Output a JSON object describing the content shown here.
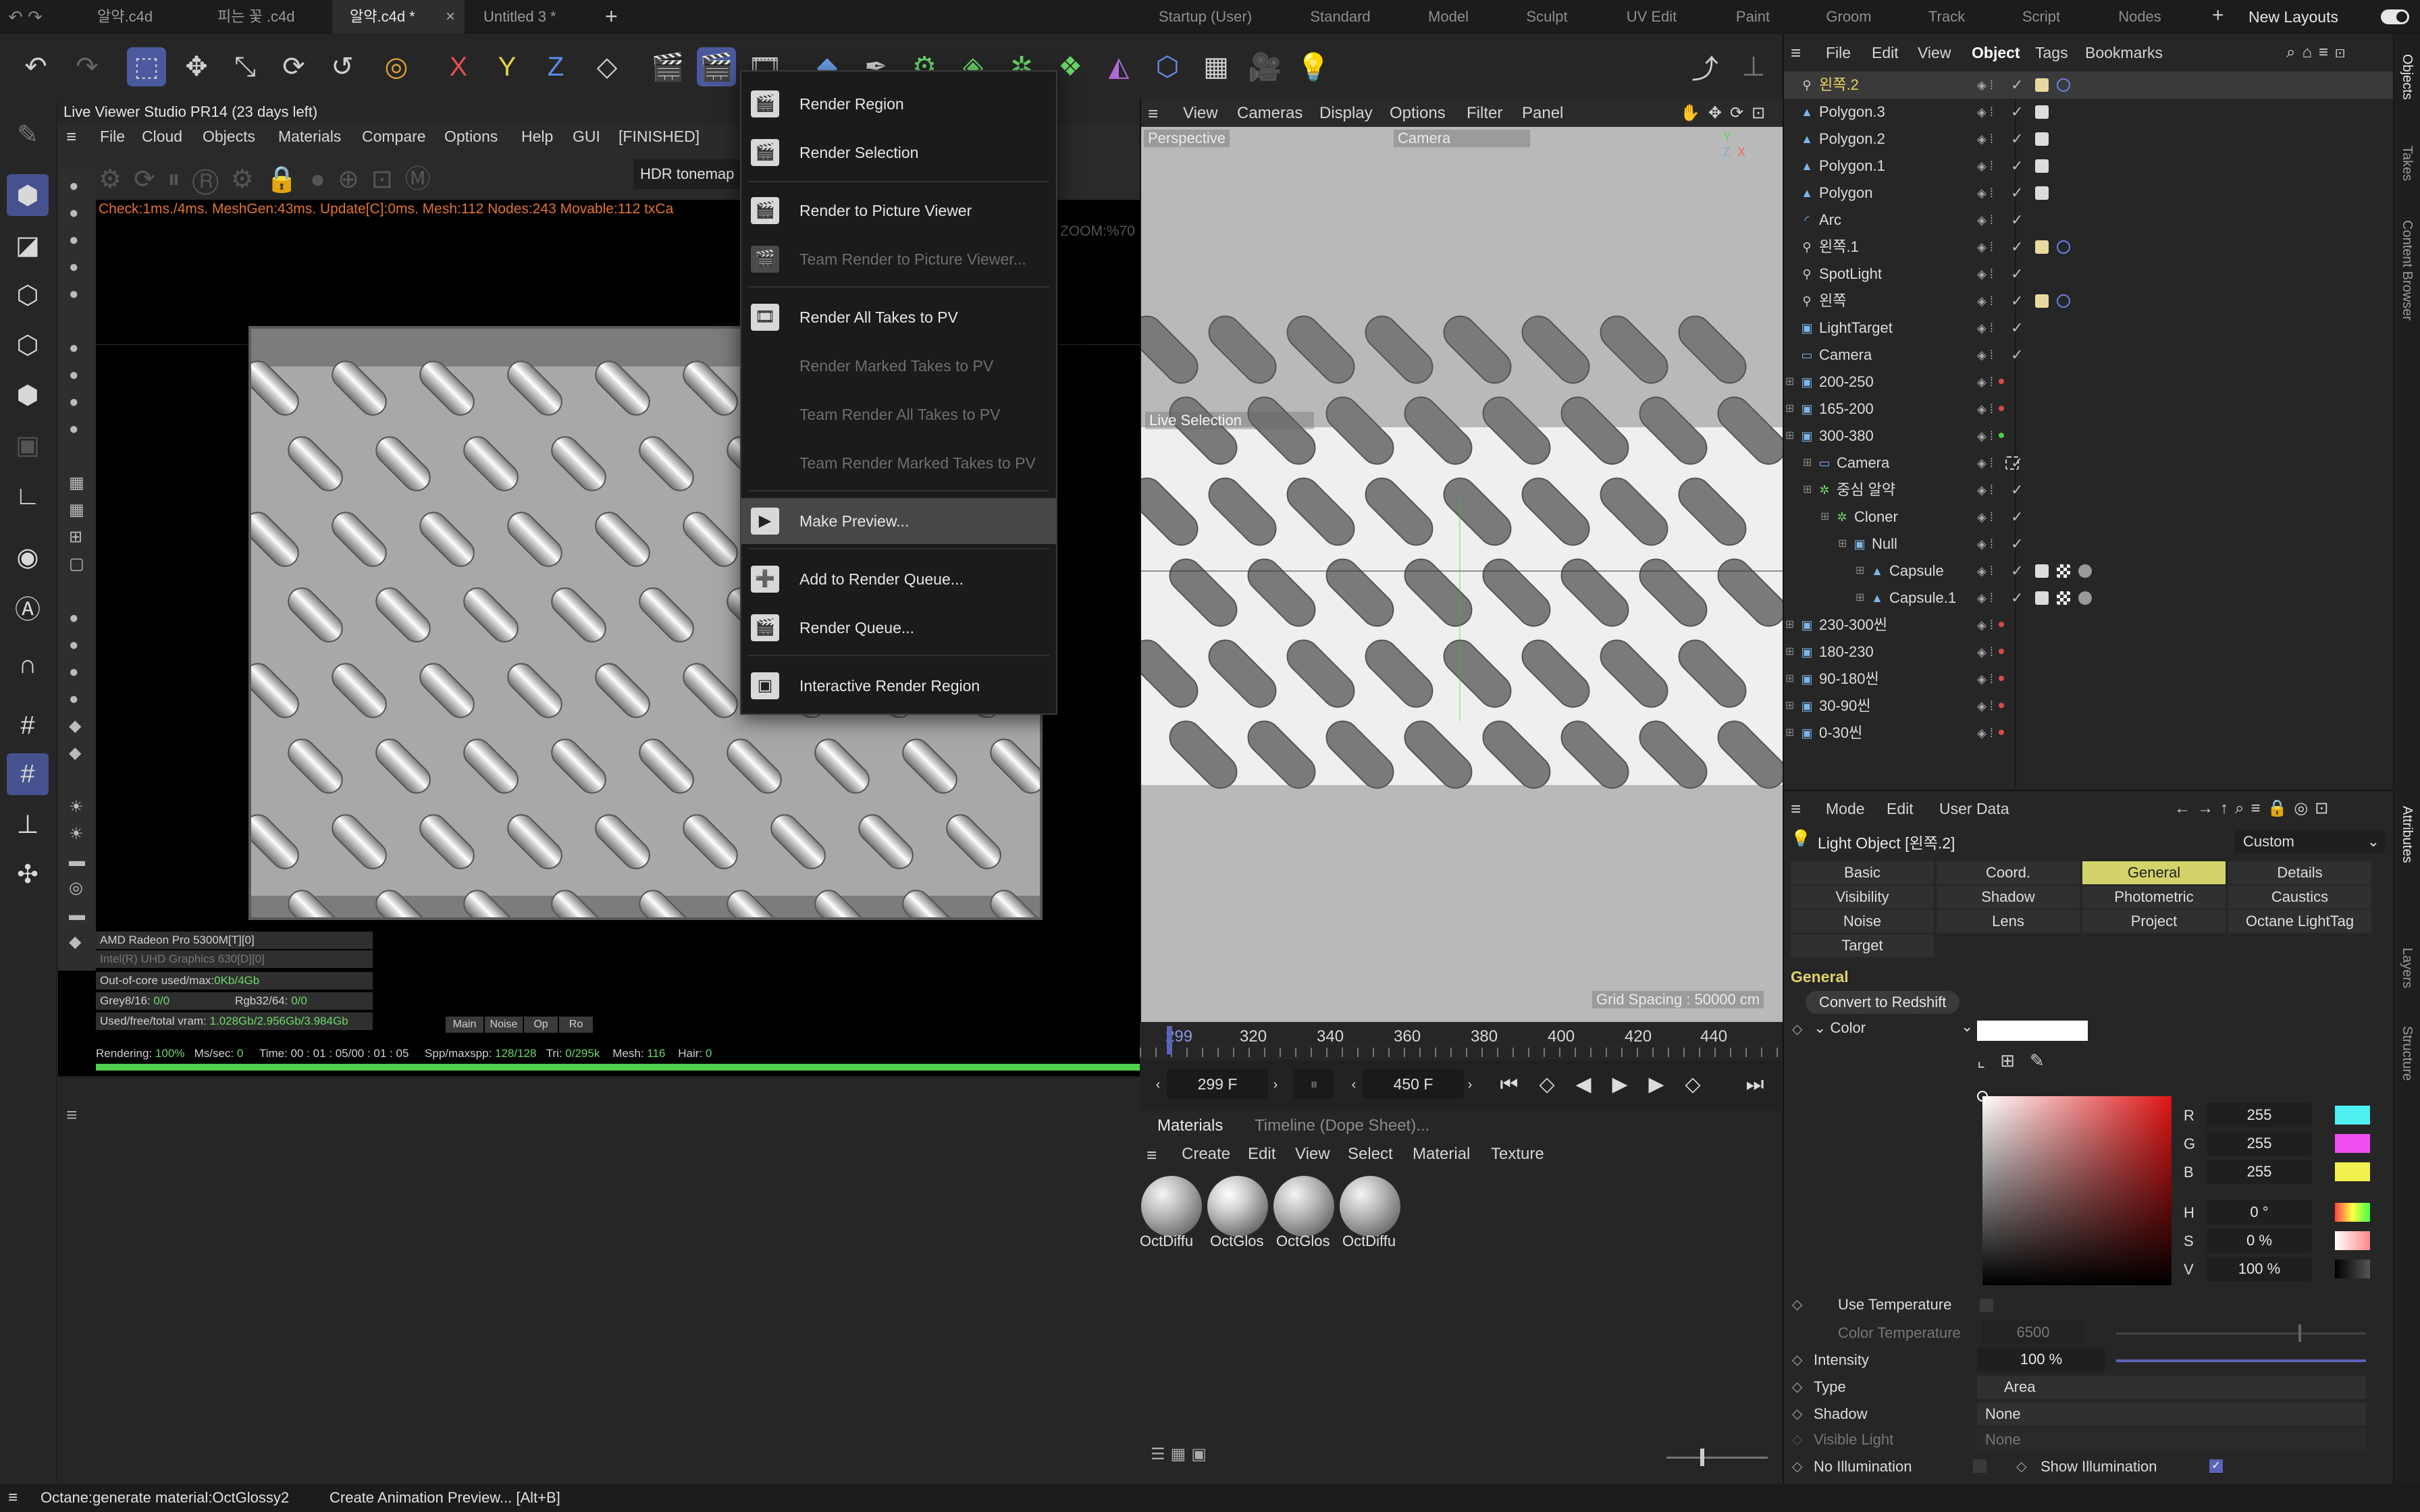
{
  "doc_tabs": [
    "알약.c4d",
    "피는 꽃 .c4d",
    "알약.c4d *",
    "Untitled 3 *"
  ],
  "layouts": [
    "Startup (User)",
    "Standard",
    "Model",
    "Sculpt",
    "UV Edit",
    "Paint",
    "Groom",
    "Track",
    "Script",
    "Nodes"
  ],
  "new_layouts": "New Layouts",
  "toolbar": {
    "x": "X",
    "y": "Y",
    "z": "Z"
  },
  "live_viewer": {
    "title": "Live Viewer Studio PR14 (23 days left)",
    "menu": [
      "File",
      "Cloud",
      "Objects",
      "Materials",
      "Compare",
      "Options",
      "Help",
      "GUI",
      "[FINISHED]"
    ],
    "tonemap": "HDR tonemap",
    "status": "Check:1ms./4ms. MeshGen:43ms. Update[C]:0ms. Mesh:112 Nodes:243 Movable:112 txCa",
    "zoom": "ZOOM:%70",
    "gpu1": "AMD Radeon Pro 5300M[T][0]",
    "gpu2": "Intel(R) UHD Graphics 630[D][0]",
    "outofcore": {
      "label": "Out-of-core used/max:",
      "value": "0Kb/4Gb"
    },
    "grey": {
      "label": "Grey8/16:",
      "value": "0/0"
    },
    "rgb": {
      "label": "Rgb32/64:",
      "value": "0/0"
    },
    "vram": {
      "label": "Used/free/total vram:",
      "value": "1.028Gb/2.956Gb/3.984Gb"
    },
    "mini_tabs": [
      "Main",
      "Noise",
      "Op",
      "Ro"
    ],
    "render_line": {
      "rendering_label": "Rendering:",
      "rendering": "100%",
      "ms_label": "Ms/sec:",
      "ms": "0",
      "time": "Time: 00 : 01 : 05/00 : 01 : 05",
      "spp_label": "Spp/maxspp:",
      "spp": "128/128",
      "tri_label": "Tri:",
      "tri": "0/295k",
      "mesh_label": "Mesh:",
      "mesh": "116",
      "hair_label": "Hair:",
      "hair": "0"
    },
    "progress": 1.0
  },
  "render_menu": {
    "items": [
      {
        "label": "Render Region",
        "enabled": true
      },
      {
        "label": "Render Selection",
        "enabled": true
      },
      {
        "label": "Render to Picture Viewer",
        "enabled": true
      },
      {
        "label": "Team Render to Picture Viewer...",
        "enabled": false
      },
      {
        "label": "Render All Takes to PV",
        "enabled": true
      },
      {
        "label": "Render Marked Takes to PV",
        "enabled": false
      },
      {
        "label": "Team Render All Takes to PV",
        "enabled": false
      },
      {
        "label": "Team Render Marked Takes to PV",
        "enabled": false
      },
      {
        "label": "Make Preview...",
        "enabled": true,
        "highlighted": true
      },
      {
        "label": "Add to Render Queue...",
        "enabled": true
      },
      {
        "label": "Render Queue...",
        "enabled": true
      },
      {
        "label": "Interactive Render Region",
        "enabled": true
      }
    ]
  },
  "viewport": {
    "menu": [
      "View",
      "Cameras",
      "Display",
      "Options",
      "Filter",
      "Panel"
    ],
    "projection": "Perspective",
    "camera": "Camera",
    "live_selection": "Live Selection",
    "grid_spacing": "Grid Spacing : 50000 cm"
  },
  "timeline": {
    "ticks": [
      "299",
      "320",
      "340",
      "360",
      "380",
      "400",
      "420",
      "440"
    ],
    "current_frame": "299 F",
    "end_frame": "450 F"
  },
  "materials": {
    "tabs": [
      "Materials",
      "Timeline (Dope Sheet)..."
    ],
    "menu": [
      "Create",
      "Edit",
      "View",
      "Select",
      "Material",
      "Texture"
    ],
    "items": [
      "OctDiffu",
      "OctGlos",
      "OctGlos",
      "OctDiffu"
    ]
  },
  "object_manager": {
    "menu": [
      "File",
      "Edit",
      "View",
      "Object",
      "Tags",
      "Bookmarks"
    ],
    "active_menu": "Object",
    "rows": [
      {
        "name": "왼쪽.2",
        "indent": 0,
        "icon": "light-icon",
        "selected": true,
        "dot": "none"
      },
      {
        "name": "Polygon.3",
        "indent": 0,
        "icon": "polygon-icon",
        "dot": "none"
      },
      {
        "name": "Polygon.2",
        "indent": 0,
        "icon": "polygon-icon",
        "dot": "none"
      },
      {
        "name": "Polygon.1",
        "indent": 0,
        "icon": "polygon-icon",
        "dot": "none"
      },
      {
        "name": "Polygon",
        "indent": 0,
        "icon": "polygon-icon",
        "dot": "none"
      },
      {
        "name": "Arc",
        "indent": 0,
        "icon": "spline-icon",
        "dot": "none"
      },
      {
        "name": "왼쪽.1",
        "indent": 0,
        "icon": "light-icon",
        "dot": "none"
      },
      {
        "name": "SpotLight",
        "indent": 0,
        "icon": "spotlight-icon",
        "dot": "none"
      },
      {
        "name": "왼쪽",
        "indent": 0,
        "icon": "light-icon",
        "dot": "none"
      },
      {
        "name": "LightTarget",
        "indent": 0,
        "icon": "null-icon",
        "dot": "none"
      },
      {
        "name": "Camera",
        "indent": 0,
        "icon": "camera-icon",
        "dot": "none"
      },
      {
        "name": "200-250",
        "indent": 0,
        "icon": "null-icon",
        "dot": "red"
      },
      {
        "name": "165-200",
        "indent": 0,
        "icon": "null-icon",
        "dot": "red"
      },
      {
        "name": "300-380",
        "indent": 0,
        "icon": "null-icon",
        "dot": "green"
      },
      {
        "name": "Camera",
        "indent": 1,
        "icon": "camera-icon",
        "dot": "none"
      },
      {
        "name": "중심 알약",
        "indent": 1,
        "icon": "cloner-icon",
        "dot": "none"
      },
      {
        "name": "Cloner",
        "indent": 2,
        "icon": "cloner-icon",
        "dot": "none"
      },
      {
        "name": "Null",
        "indent": 3,
        "icon": "null-icon",
        "dot": "none"
      },
      {
        "name": "Capsule",
        "indent": 4,
        "icon": "capsule-icon",
        "dot": "none"
      },
      {
        "name": "Capsule.1",
        "indent": 4,
        "icon": "capsule-icon",
        "dot": "none"
      },
      {
        "name": "230-300씬",
        "indent": 0,
        "icon": "null-icon",
        "dot": "red"
      },
      {
        "name": "180-230",
        "indent": 0,
        "icon": "null-icon",
        "dot": "red"
      },
      {
        "name": "90-180씬",
        "indent": 0,
        "icon": "null-icon",
        "dot": "red"
      },
      {
        "name": "30-90씬",
        "indent": 0,
        "icon": "null-icon",
        "dot": "red"
      },
      {
        "name": "0-30씬",
        "indent": 0,
        "icon": "null-icon",
        "dot": "red"
      }
    ]
  },
  "attributes": {
    "menu": [
      "Mode",
      "Edit",
      "User Data"
    ],
    "object_title": "Light Object [왼쪽.2]",
    "preset": "Custom",
    "tabs": [
      [
        "Basic",
        "Coord.",
        "General",
        "Details"
      ],
      [
        "Visibility",
        "Shadow",
        "Photometric",
        "Caustics"
      ],
      [
        "Noise",
        "Lens",
        "Project",
        "Octane LightTag"
      ],
      [
        "Target"
      ]
    ],
    "active_tab": "General",
    "section": "General",
    "convert_button": "Convert to Redshift",
    "color_label": "Color",
    "rgb": {
      "R": "255",
      "G": "255",
      "B": "255"
    },
    "hsv": {
      "H": "0 °",
      "S": "0 %",
      "V": "100 %"
    },
    "use_temperature": "Use Temperature",
    "color_temperature": {
      "label": "Color Temperature",
      "value": "6500"
    },
    "intensity": {
      "label": "Intensity",
      "value": "100 %"
    },
    "type": {
      "label": "Type",
      "value": "Area"
    },
    "shadow": {
      "label": "Shadow",
      "value": "None"
    },
    "visible_light": {
      "label": "Visible Light",
      "value": "None"
    },
    "no_illumination": "No Illumination",
    "show_illumination": "Show Illumination"
  },
  "edge_tabs": [
    "Objects",
    "Takes",
    "Content Browser",
    "Attributes",
    "Layers",
    "Structure"
  ],
  "statusbar": {
    "left": "Octane:generate material:OctGlossy2",
    "right": "Create Animation Preview... [Alt+B]"
  }
}
